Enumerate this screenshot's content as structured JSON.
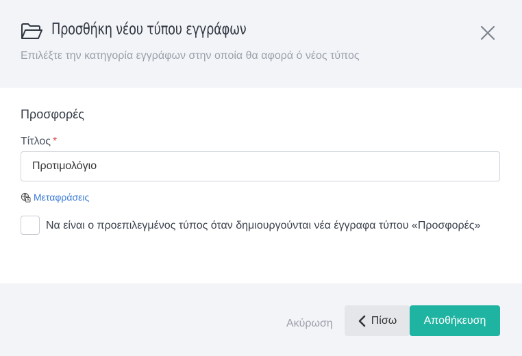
{
  "dialog": {
    "title": "Προσθήκη νέου τύπου εγγράφων",
    "subtitle": "Επιλέξτε την κατηγορία εγγράφων στην οποία θα αφορά ό νέος τύπος",
    "icon": "folder-open-icon",
    "close_icon": "close-icon"
  },
  "form": {
    "category": "Προσφορές",
    "title_label": "Τίτλος",
    "required_mark": "*",
    "title_value": "Προτιμολόγιο",
    "translations_link": "Μεταφράσεις",
    "translations_icon": "globe-icon",
    "default_checkbox_label": "Να είναι ο προεπιλεγμένος τύπος όταν δημιουργούνται νέα έγγραφα τύπου «Προσφορές»",
    "default_checked": false
  },
  "footer": {
    "cancel_label": "Ακύρωση",
    "back_label": "Πίσω",
    "save_label": "Αποθήκευση"
  },
  "colors": {
    "header_bg": "#f3f4f8",
    "primary": "#1fb3a1",
    "link": "#3a7bd5",
    "required": "#d9534f"
  }
}
